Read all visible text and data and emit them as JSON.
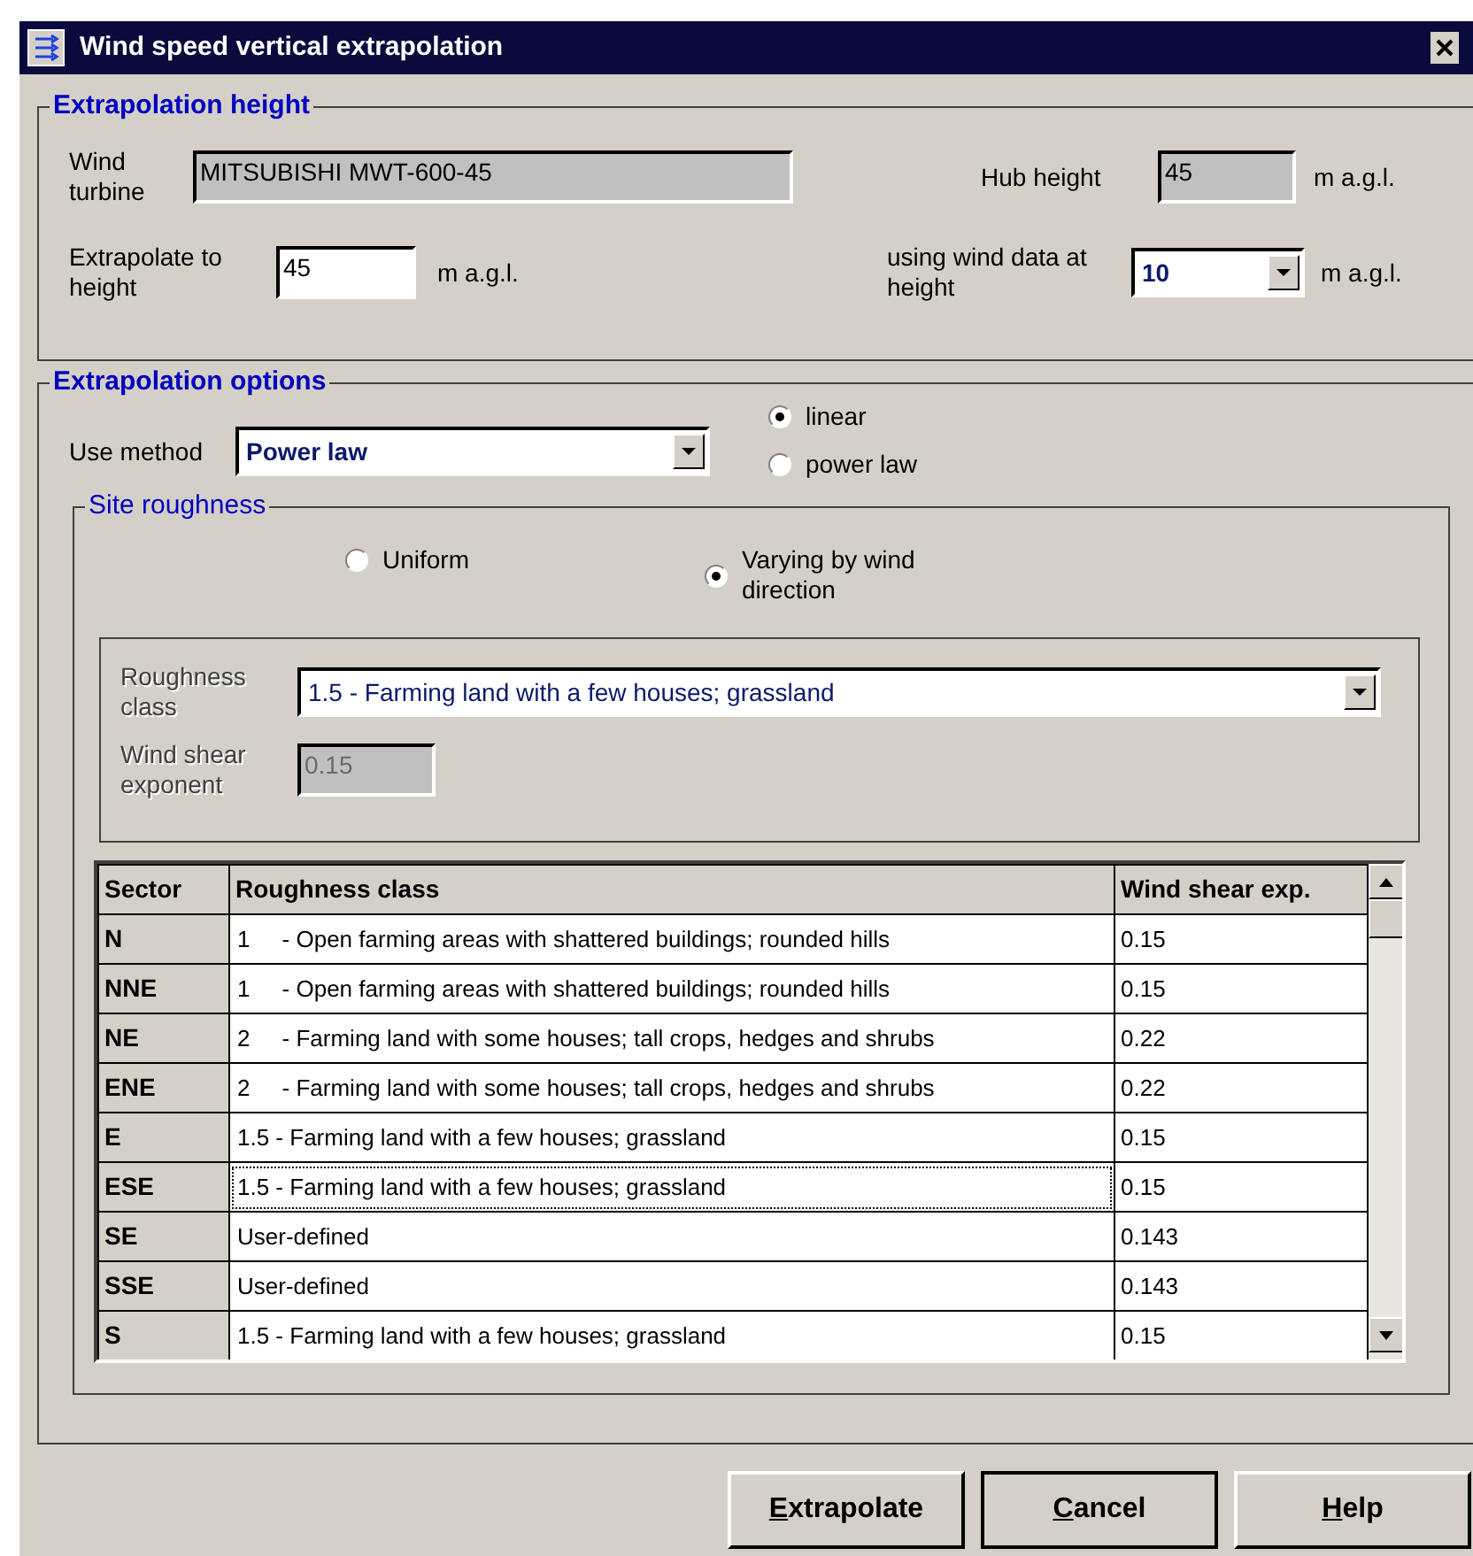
{
  "window": {
    "title": "Wind speed vertical extrapolation"
  },
  "extrapolation_height": {
    "title": "Extrapolation height",
    "wind_turbine": {
      "label": "Wind turbine",
      "value": "MITSUBISHI MWT-600-45",
      "disabled": true
    },
    "hub_height": {
      "label": "Hub height",
      "value": "45",
      "unit": "m a.g.l.",
      "disabled": true
    },
    "extrapolate_to": {
      "label": "Extrapolate to height",
      "value": "45",
      "unit": "m a.g.l."
    },
    "data_height": {
      "label": "using wind data at height",
      "value": "10",
      "unit": "m a.g.l."
    }
  },
  "extrapolation_options": {
    "title": "Extrapolation options",
    "method": {
      "label": "Use method",
      "value": "Power law"
    },
    "interpolation": [
      {
        "label": "linear",
        "selected": true
      },
      {
        "label": "power law",
        "selected": false
      }
    ],
    "site_roughness": {
      "title": "Site roughness",
      "mode": [
        {
          "label": "Uniform",
          "selected": false
        },
        {
          "label": "Varying by wind direction",
          "selected": true
        }
      ],
      "roughness_class": {
        "label": "Roughness class",
        "value": "1.5 - Farming land with a few houses; grassland",
        "disabled": true
      },
      "wind_shear": {
        "label": "Wind shear exponent",
        "value": "0.15",
        "disabled": true
      },
      "table": {
        "columns": [
          "Sector",
          "Roughness class",
          "Wind shear exp."
        ],
        "rows": [
          {
            "sector": "N",
            "roughness": "1     - Open farming areas with shattered buildings; rounded hills",
            "shear": "0.15",
            "focused": false
          },
          {
            "sector": "NNE",
            "roughness": "1     - Open farming areas with shattered buildings; rounded hills",
            "shear": "0.15",
            "focused": false
          },
          {
            "sector": "NE",
            "roughness": "2     - Farming land with some houses; tall crops, hedges and shrubs",
            "shear": "0.22",
            "focused": false
          },
          {
            "sector": "ENE",
            "roughness": "2     - Farming land with some houses; tall crops, hedges and shrubs",
            "shear": "0.22",
            "focused": false
          },
          {
            "sector": "E",
            "roughness": "1.5 - Farming land with a few houses; grassland",
            "shear": "0.15",
            "focused": false
          },
          {
            "sector": "ESE",
            "roughness": "1.5 - Farming land with a few houses; grassland",
            "shear": "0.15",
            "focused": true
          },
          {
            "sector": "SE",
            "roughness": "User-defined",
            "shear": "0.143",
            "focused": false
          },
          {
            "sector": "SSE",
            "roughness": "User-defined",
            "shear": "0.143",
            "focused": false
          },
          {
            "sector": "S",
            "roughness": "1.5 - Farming land with a few houses; grassland",
            "shear": "0.15",
            "focused": false
          }
        ]
      }
    }
  },
  "buttons": [
    {
      "label": "Extrapolate",
      "default": false
    },
    {
      "label": "Cancel",
      "default": true
    },
    {
      "label": "Help",
      "default": false
    }
  ]
}
